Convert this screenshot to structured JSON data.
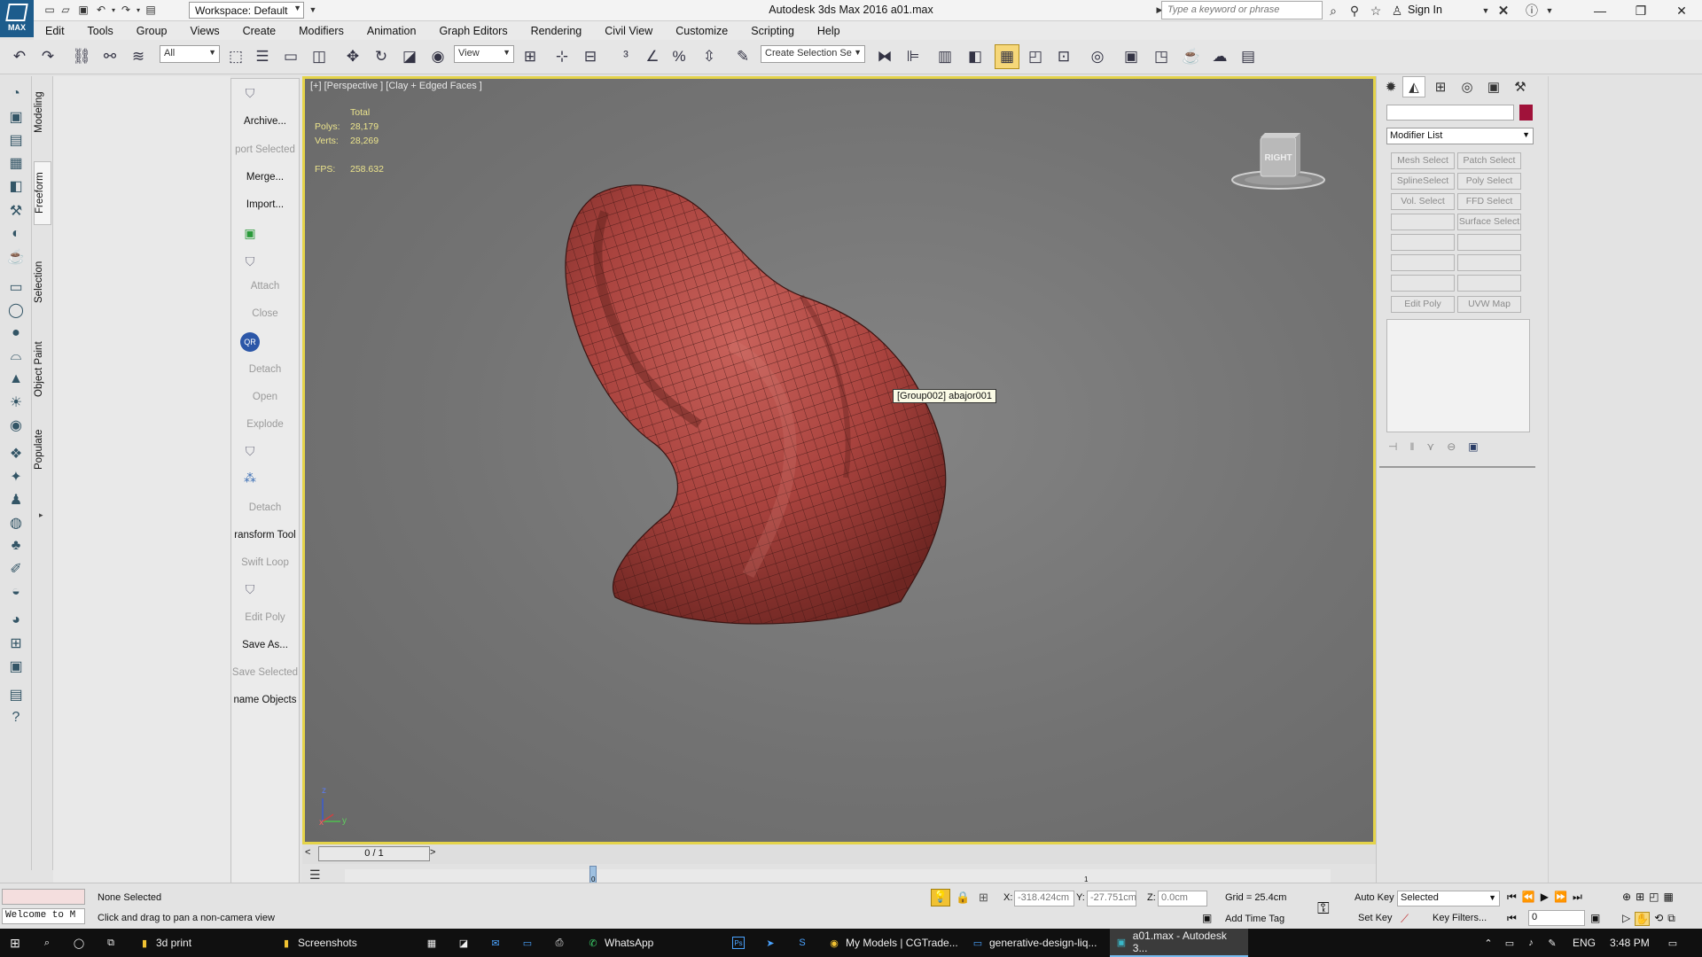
{
  "app": {
    "title": "Autodesk 3ds Max 2016    a01.max",
    "logo_label": "MAX",
    "workspace": "Workspace: Default",
    "search_placeholder": "Type a keyword or phrase",
    "sign_in": "Sign In"
  },
  "menu": [
    "Edit",
    "Tools",
    "Group",
    "Views",
    "Create",
    "Modifiers",
    "Animation",
    "Graph Editors",
    "Rendering",
    "Civil View",
    "Customize",
    "Scripting",
    "Help"
  ],
  "toolbar": {
    "selection_filter": "All",
    "ref_coord": "View",
    "named_selection_placeholder": "Create Selection Se"
  },
  "ribbon_tabs": [
    "Modeling",
    "Freeform",
    "Selection",
    "Object Paint",
    "Populate"
  ],
  "ribbon_panel": {
    "items": [
      "Archive...",
      "port Selected",
      "Merge...",
      "Import...",
      "Attach",
      "Close",
      "Detach",
      "Open",
      "Explode",
      "Detach",
      "ransform Tool",
      "Swift Loop",
      "Edit Poly",
      "Save As...",
      "Save Selected",
      "name Objects"
    ],
    "disabled": [
      "Attach",
      "Close",
      "Detach",
      "Open",
      "Explode",
      "Swift Loop",
      "Edit Poly",
      "Save Selected",
      "port Selected"
    ]
  },
  "viewport": {
    "label": "[+] [Perspective ] [Clay + Edged Faces ]",
    "stats_header": "Total",
    "polys_label": "Polys:",
    "polys": "28,179",
    "verts_label": "Verts:",
    "verts": "28,269",
    "fps_label": "FPS:",
    "fps": "258.632",
    "tooltip": "[Group002] abajor001",
    "viewcube_face": "RIGHT",
    "axis_z": "z",
    "axis_x": "x",
    "axis_y": "y",
    "mesh_color": "#b24a45"
  },
  "command_panel": {
    "modifier_list": "Modifier List",
    "buttons": [
      "Mesh Select",
      "Patch Select",
      "SplineSelect",
      "Poly Select",
      "Vol. Select",
      "FFD Select",
      "",
      "Surface Select",
      "",
      "",
      "",
      "",
      "",
      "",
      "Edit Poly",
      "UVW Map"
    ],
    "swatch_color": "#a0123a"
  },
  "timeline": {
    "frame": "0 / 1",
    "prev": "<",
    "next": ">",
    "tick_0": "0",
    "tick_1": "1"
  },
  "status": {
    "selection": "None Selected",
    "prompt": "Click and drag to pan a non-camera view",
    "maxscript": "Welcome to M",
    "x_label": "X:",
    "x": "-318.424cm",
    "y_label": "Y:",
    "y": "-27.751cm",
    "z_label": "Z:",
    "z": "0.0cm",
    "grid": "Grid = 25.4cm",
    "add_time_tag": "Add Time Tag",
    "auto_key": "Auto Key",
    "set_key": "Set Key",
    "key_mode": "Selected",
    "key_filters": "Key Filters...",
    "frame_field": "0"
  },
  "taskbar": {
    "items": [
      "3d print",
      "Screenshots",
      "WhatsApp",
      "My Models | CGTrade...",
      "generative-design-liq...",
      "a01.max - Autodesk 3..."
    ],
    "lang": "ENG",
    "time": "3:48 PM"
  }
}
